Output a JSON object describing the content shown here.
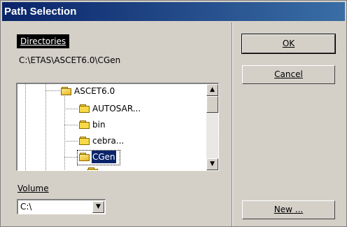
{
  "dialog": {
    "title": "Path Selection"
  },
  "directories": {
    "label": "Directories",
    "current_path": "C:\\ETAS\\ASCET6.0\\CGen"
  },
  "tree": {
    "items": [
      {
        "label": "ASCET6.0",
        "icon": "folder-open-icon"
      },
      {
        "label": "AUTOSAR...",
        "icon": "folder-icon"
      },
      {
        "label": "bin",
        "icon": "folder-icon"
      },
      {
        "label": "cebra...",
        "icon": "folder-icon"
      },
      {
        "label": "CGen",
        "icon": "folder-open-icon",
        "selected": true
      }
    ]
  },
  "volume": {
    "label": "Volume",
    "value": "C:\\"
  },
  "buttons": {
    "ok": "OK",
    "cancel": "Cancel",
    "new": "New ..."
  },
  "colors": {
    "titlebar": "#0a246a",
    "selection": "#0a246a",
    "face": "#d4d0c8"
  }
}
